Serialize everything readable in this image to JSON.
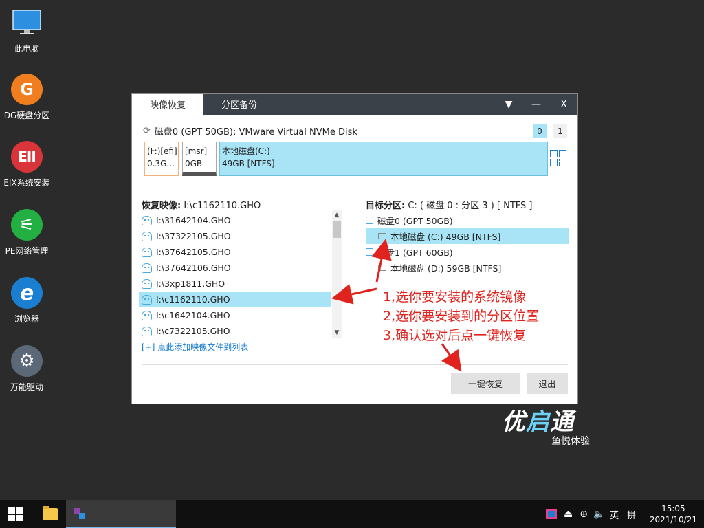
{
  "desktop": {
    "icons": [
      {
        "label": "此电脑",
        "glyph": ""
      },
      {
        "label": "DG硬盘分区",
        "glyph": "G"
      },
      {
        "label": "EIX系统安装",
        "glyph": "EII"
      },
      {
        "label": "PE网络管理",
        "glyph": "⚟"
      },
      {
        "label": "浏览器",
        "glyph": "e"
      },
      {
        "label": "万能驱动",
        "glyph": "⚙"
      }
    ]
  },
  "dialog": {
    "tabs": [
      "映像恢复",
      "分区备份"
    ],
    "controls": {
      "dropdown": "▼",
      "minimize": "—",
      "close": "X"
    },
    "disk_title": "磁盘0 (GPT 50GB): VMware Virtual NVMe Disk",
    "disk_numbers": [
      "0",
      "1"
    ],
    "partitions": [
      {
        "line1": "(F:)[efi]",
        "line2": "0.3G..."
      },
      {
        "line1": "[msr]",
        "line2": "0GB"
      },
      {
        "line1": "本地磁盘(C:)",
        "line2": "49GB [NTFS]"
      }
    ],
    "restore_label": "恢复映像:",
    "restore_value": "I:\\c1162110.GHO",
    "images": [
      "I:\\31642104.GHO",
      "I:\\37322105.GHO",
      "I:\\37642105.GHO",
      "I:\\37642106.GHO",
      "I:\\3xp1811.GHO",
      "I:\\c1162110.GHO",
      "I:\\c1642104.GHO",
      "I:\\c7322105.GHO"
    ],
    "selected_image_index": 5,
    "add_link": "[+] 点此添加映像文件到列表",
    "target_label": "目标分区:",
    "target_value": "C: ( 磁盘 0 : 分区 3 ) [ NTFS ]",
    "tree": [
      {
        "label": "磁盘0 (GPT 50GB)",
        "type": "disk"
      },
      {
        "label": "本地磁盘 (C:) 49GB [NTFS]",
        "type": "part",
        "selected": true
      },
      {
        "label": "磁盘1 (GPT 60GB)",
        "type": "disk"
      },
      {
        "label": "本地磁盘 (D:) 59GB [NTFS]",
        "type": "part"
      }
    ],
    "btn_restore": "一键恢复",
    "btn_exit": "退出"
  },
  "annotation": {
    "lines": [
      "1,选你要安装的系统镜像",
      "2,选你要安装到的分区位置",
      "3,确认选对后点一键恢复"
    ],
    "color": "#e0231e"
  },
  "brand": {
    "logo_a": "优",
    "logo_b": "启",
    "logo_c": "通",
    "sub": "鱼悦体验"
  },
  "taskbar": {
    "tray_lang": "英",
    "tray_ime": "拼",
    "time": "15:05",
    "date": "2021/10/21"
  }
}
